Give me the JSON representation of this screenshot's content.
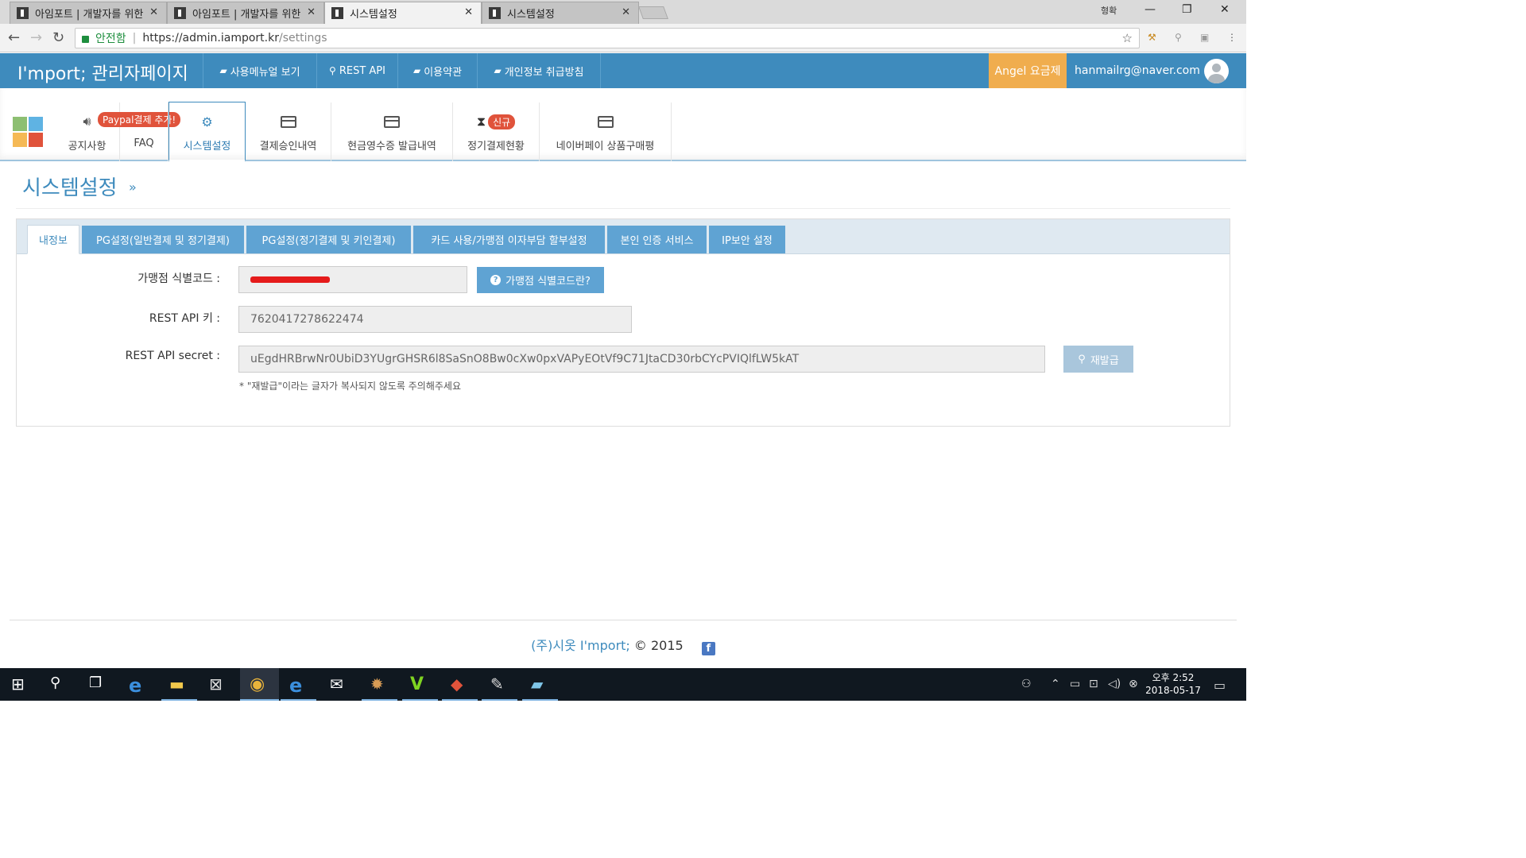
{
  "browser": {
    "tabs": [
      {
        "title": "아임포트 | 개발자를 위한"
      },
      {
        "title": "아임포트 | 개발자를 위한"
      },
      {
        "title": "시스템설정"
      },
      {
        "title": "시스템설정"
      }
    ],
    "profile_label": "형확",
    "address": {
      "secure_label": "안전함",
      "url_host": "https://admin.iamport.kr",
      "url_path": "/settings"
    }
  },
  "header": {
    "brand": "I'mport; 관리자페이지",
    "menu": [
      {
        "label": "사용메뉴얼 보기"
      },
      {
        "label": "REST API"
      },
      {
        "label": "이용약관"
      },
      {
        "label": "개인정보 취급방침"
      }
    ],
    "plan_label": "Angel 요금제",
    "user_email": "hanmailrg@naver.com"
  },
  "subnav": {
    "items": [
      {
        "label": "공지사항",
        "badge": "Paypal결제 추가!"
      },
      {
        "label": "FAQ"
      },
      {
        "label": "시스템설정"
      },
      {
        "label": "결제승인내역"
      },
      {
        "label": "현금영수증 발급내역"
      },
      {
        "label": "정기결제현황",
        "badge": "신규"
      },
      {
        "label": "네이버페이 상품구매평"
      }
    ]
  },
  "page": {
    "title": "시스템설정",
    "title_suffix": "»"
  },
  "settings": {
    "tabs": [
      {
        "label": "내정보"
      },
      {
        "label": "PG설정(일반결제 및 정기결제)"
      },
      {
        "label": "PG설정(정기결제 및 키인결제)"
      },
      {
        "label": "카드 사용/가맹점 이자부담 할부설정"
      },
      {
        "label": "본인 인증 서비스"
      },
      {
        "label": "IP보안 설정"
      }
    ],
    "merchant_code_label": "가맹점 식별코드 :",
    "merchant_code_help": "가맹점 식별코드란?",
    "rest_api_key_label": "REST API 키 :",
    "rest_api_key_value": "7620417278622474",
    "rest_api_secret_label": "REST API secret :",
    "rest_api_secret_value": "uEgdHRBrwNr0UbiD3YUgrGHSR6l8SaSnO8Bw0cXw0pxVAPyEOtVf9C71JtaCD30rbCYcPVIQlfLW5kAT",
    "reissue_label": "재발급",
    "note": "* \"재발급\"이라는 글자가 복사되지 않도록 주의해주세요"
  },
  "footer": {
    "company": "(주)시옷",
    "brand": "I'mport;",
    "copyright": "© 2015"
  },
  "taskbar": {
    "clock_time": "오후 2:52",
    "clock_date": "2018-05-17"
  },
  "colors": {
    "header_blue": "#3e8bbd",
    "plan_orange": "#f0ad4e",
    "tab_blue": "#5fa3d3",
    "badge_red": "#e0533b"
  }
}
